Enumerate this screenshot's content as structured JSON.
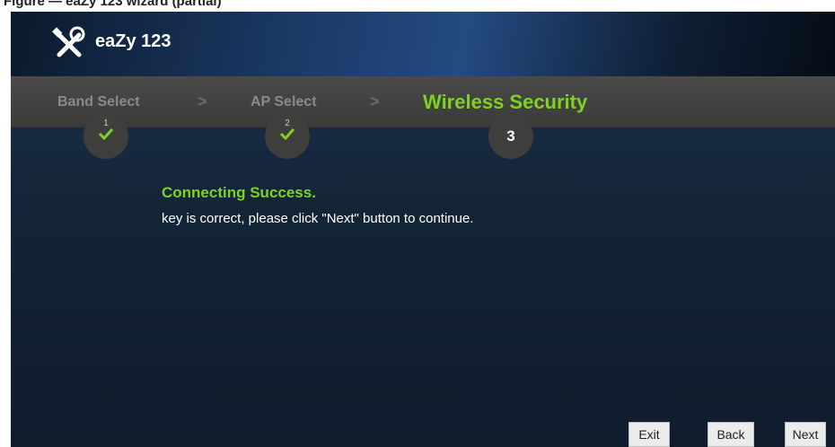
{
  "caption": "Figure — eaZy 123 wizard (partial)",
  "header": {
    "title": "eaZy 123",
    "icon": "tools-icon"
  },
  "steps": [
    {
      "label": "Band Select",
      "number": "1",
      "state": "done"
    },
    {
      "label": "AP Select",
      "number": "2",
      "state": "done"
    },
    {
      "label": "Wireless Security",
      "number": "3",
      "state": "active"
    }
  ],
  "separators": [
    ">",
    ">"
  ],
  "content": {
    "title": "Connecting Success.",
    "message": "key is correct, please click \"Next\" button to continue."
  },
  "buttons": {
    "exit": "Exit",
    "back": "Back",
    "next": "Next"
  },
  "colors": {
    "accent": "#7ed321",
    "background": "#142438"
  }
}
